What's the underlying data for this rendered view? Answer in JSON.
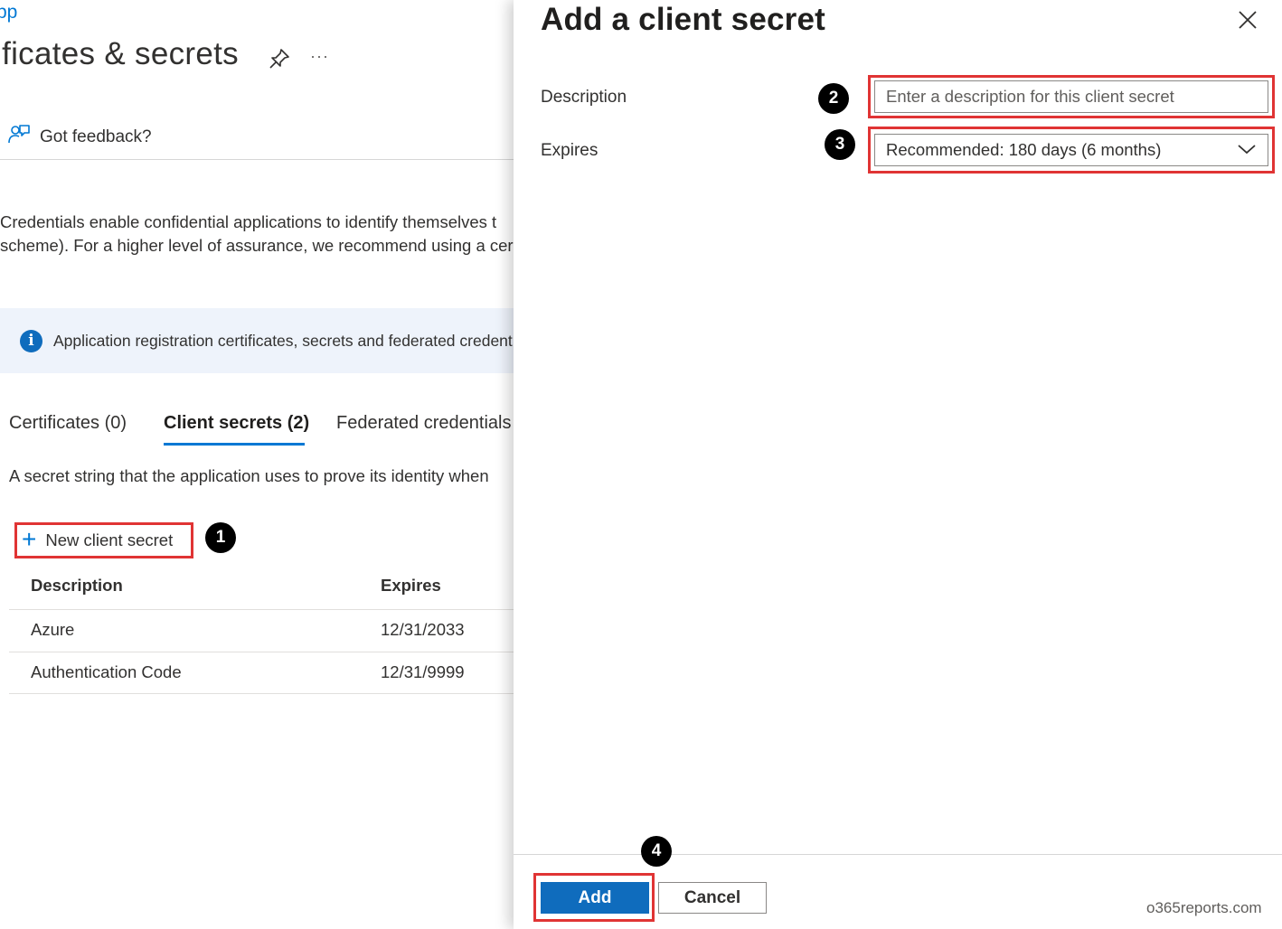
{
  "background_page": {
    "breadcrumb": "pp",
    "title": "ificates & secrets",
    "pin_icon": "pin-icon",
    "more_label": "···",
    "feedback_label": "Got feedback?",
    "intro_lines": [
      "Credentials enable confidential applications to identify themselves t",
      "scheme). For a higher level of assurance, we recommend using a cer"
    ],
    "info_banner": "Application registration certificates, secrets and federated credent",
    "tabs": [
      {
        "label": "Certificates (0)",
        "active": false
      },
      {
        "label": "Client secrets (2)",
        "active": true
      },
      {
        "label": "Federated credentials",
        "active": false
      }
    ],
    "tab_description": "A secret string that the application uses to prove its identity when",
    "new_secret_label": "New client secret",
    "table": {
      "headers": [
        "Description",
        "Expires"
      ],
      "rows": [
        [
          "Azure",
          "12/31/2033"
        ],
        [
          "Authentication Code",
          "12/31/9999"
        ]
      ]
    }
  },
  "panel": {
    "title": "Add a client secret",
    "description_label": "Description",
    "description_placeholder": "Enter a description for this client secret",
    "description_value": "",
    "expires_label": "Expires",
    "expires_value": "Recommended: 180 days (6 months)",
    "add_label": "Add",
    "cancel_label": "Cancel",
    "watermark": "o365reports.com"
  },
  "step_badges": [
    "1",
    "2",
    "3",
    "4"
  ],
  "colors": {
    "accent": "#0078d4",
    "primary_button": "#0f6cbd",
    "highlight": "#e03434",
    "info_bar": "#eef3fb"
  }
}
